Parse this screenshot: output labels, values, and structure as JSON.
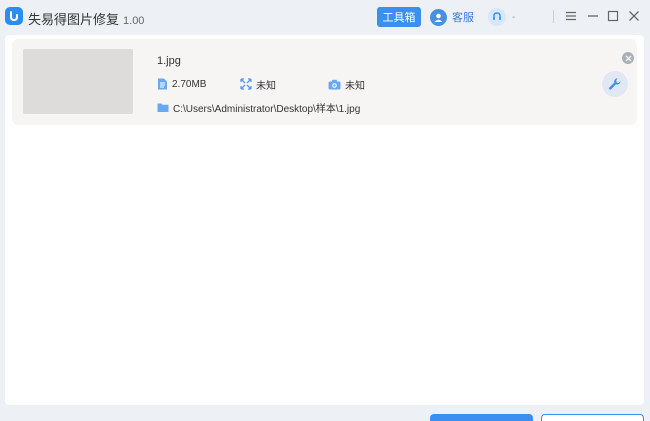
{
  "app": {
    "title": "失易得图片修复",
    "version": "1.00"
  },
  "header": {
    "toolbox_label": "工具箱",
    "service_label": "客服",
    "account_label": "-"
  },
  "file": {
    "name": "1.jpg",
    "size": "2.70MB",
    "resolution": "未知",
    "device": "未知",
    "path": "C:\\Users\\Administrator\\Desktop\\样本\\1.jpg"
  },
  "colors": {
    "accent": "#3a8ff0",
    "card_bg": "#f6f5f4",
    "window_bg": "#edf0f5"
  },
  "icons": [
    "app-logo-icon",
    "service-icon",
    "account-icon",
    "menu-icon",
    "minimize-icon",
    "maximize-icon",
    "close-icon",
    "file-size-icon",
    "resolution-icon",
    "camera-icon",
    "folder-icon",
    "remove-icon",
    "wrench-icon"
  ]
}
